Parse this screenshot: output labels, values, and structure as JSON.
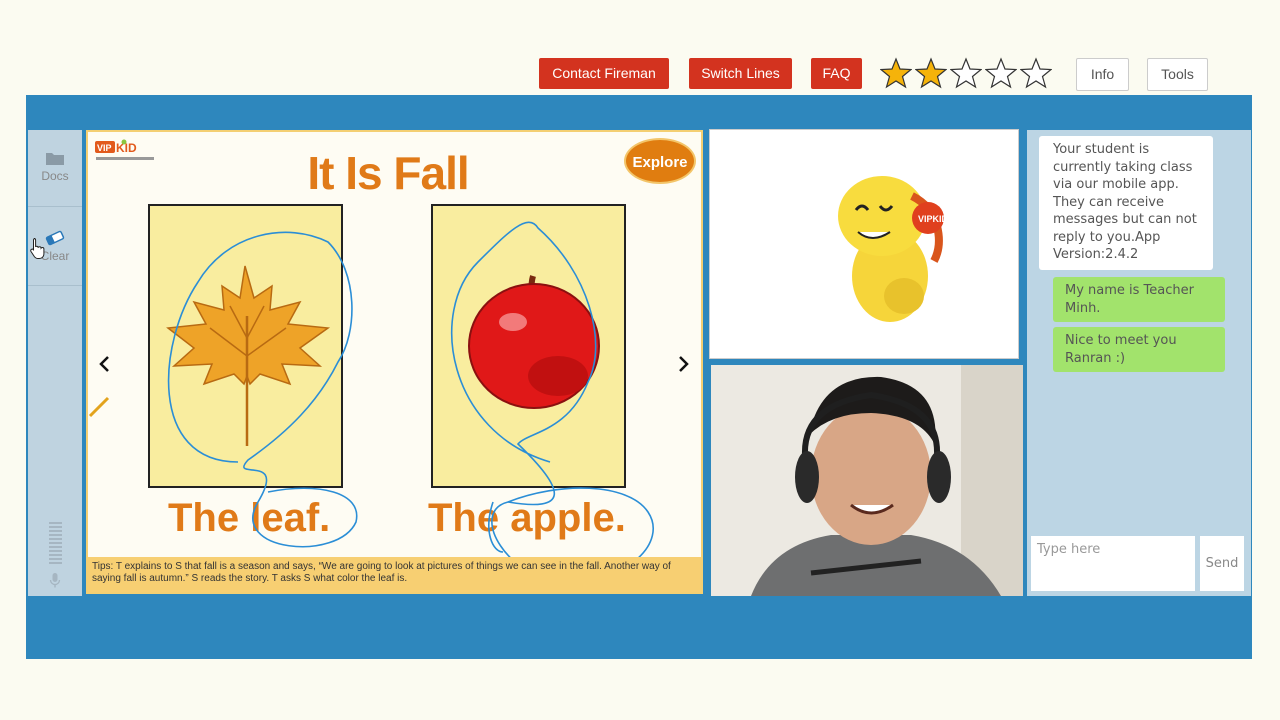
{
  "toolbar": {
    "contact_label": "Contact Fireman",
    "switch_label": "Switch Lines",
    "faq_label": "FAQ",
    "info_label": "Info",
    "tools_label": "Tools",
    "rating": 2,
    "rating_max": 5,
    "accent_red": "#d3331f",
    "star_color": "#f5b30a"
  },
  "sidebar": {
    "docs_label": "Docs",
    "clear_label": "Clear"
  },
  "slide": {
    "logo_text": "VIPKID",
    "title": "It Is Fall",
    "explore_label": "Explore",
    "cards": [
      {
        "caption": "The leaf.",
        "image": "maple-leaf"
      },
      {
        "caption": "The apple.",
        "image": "red-apple"
      }
    ],
    "tips": "Tips: T explains to S that fall is a season and says, “We are going to look at pictures of things we can see in the fall. Another way of saying fall is autumn.” S reads the story. T asks S what color the leaf is.",
    "prev_icon": "chevron-left-icon",
    "next_icon": "chevron-right-icon"
  },
  "chat": {
    "messages": [
      {
        "from": "system",
        "text": "Your student is currently taking class via our mobile app. They can receive messages but can not reply to you.App Version:2.4.2"
      },
      {
        "from": "teacher",
        "text": "My name is Teacher Minh."
      },
      {
        "from": "teacher",
        "text": "Nice to meet you Ranran :)"
      }
    ],
    "input_placeholder": "Type here",
    "send_label": "Send"
  }
}
